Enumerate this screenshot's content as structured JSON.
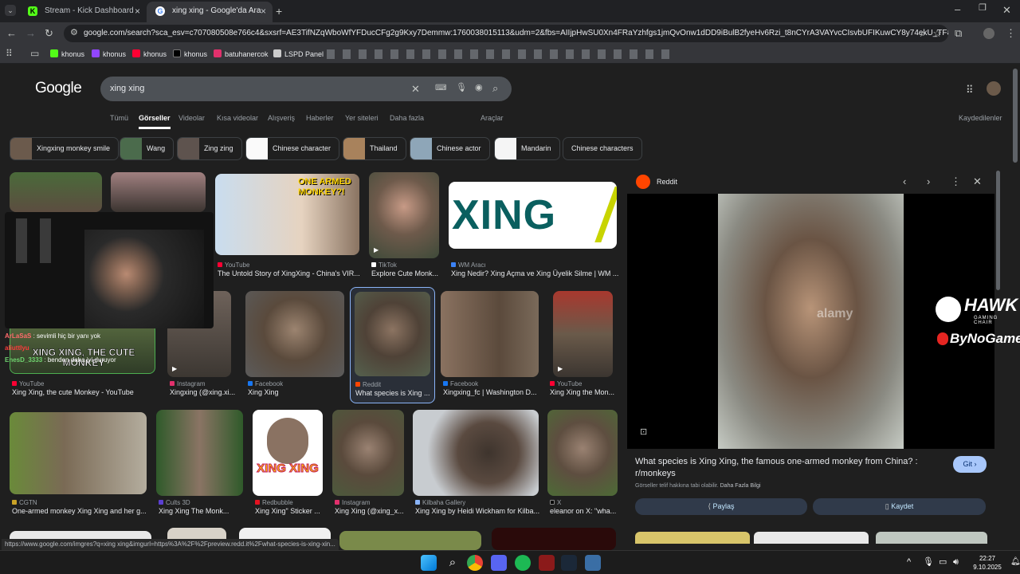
{
  "browser": {
    "tabs": [
      {
        "label": "Stream - Kick Dashboard"
      },
      {
        "label": "xing xing - Google'da Ara"
      }
    ],
    "url": "google.com/search?sca_esv=c707080508e766c4&sxsrf=AE3TifNZqWboWfYFDucCFg2g9Kxy7Demmw:1760038015113&udm=2&fbs=AIIjpHwSU0Xn4FRaYzhfgs1jmQvOnw1dDD9iBulB2fyeHv6Rzi_t8nCYrA3VAYvcCIsvbUFIKuwCY8y74ekU_TF8DEwKt3g...",
    "bookmarks": [
      "khonus",
      "khonus",
      "khonus",
      "khonus",
      "batuhanercok",
      "LSPD Panel"
    ]
  },
  "google": {
    "logo": "Google",
    "query": "xing xing",
    "nav": [
      "Tümü",
      "Görseller",
      "Videolar",
      "Kısa videolar",
      "Alışveriş",
      "Haberler",
      "Yer siteleri",
      "Daha fazla",
      "Araçlar"
    ],
    "saved": "Kaydedilenler",
    "chips": [
      "Xingxing monkey smile",
      "Wang",
      "Zing zing",
      "Chinese character",
      "Thailand",
      "Chinese actor",
      "Mandarin",
      "Chinese characters"
    ]
  },
  "results": [
    {
      "source": "YouTube",
      "title": "The Untold Story of XingXing - China's VIR...",
      "thumb_text": "ONE ARMED MONKEY?!"
    },
    {
      "source": "TikTok",
      "title": "Explore Cute Monk..."
    },
    {
      "source": "WM Aracı",
      "title": "Xing Nedir? Xing Açma ve Xing Üyelik Silme | WM ...",
      "thumb_text": "XING"
    },
    {
      "source": "YouTube",
      "title": "Xing Xing, the cute Monkey - YouTube",
      "thumb_text": "XING XING, THE CUTE MONKEY"
    },
    {
      "source": "Instagram",
      "title": "Xingxing (@xing.xi..."
    },
    {
      "source": "Facebook",
      "title": "Xing Xing"
    },
    {
      "source": "Reddit",
      "title": "What species is Xing ..."
    },
    {
      "source": "Facebook",
      "title": "Xingxing_fc | Washington D..."
    },
    {
      "source": "YouTube",
      "title": "Xing Xing the Mon..."
    },
    {
      "source": "CGTN",
      "title": "One-armed monkey Xing Xing and her g..."
    },
    {
      "source": "Cults 3D",
      "title": "Xing Xing The Monk..."
    },
    {
      "source": "Redbubble",
      "title": "Xing Xing\" Sticker ...",
      "thumb_text": "XING XING"
    },
    {
      "source": "Instagram",
      "title": "Xing Xing (@xing_x..."
    },
    {
      "source": "Kilbaha Gallery",
      "title": "Xing Xing by Heidi Wickham for Kilba..."
    },
    {
      "source": "X",
      "title": "eleanor on X: \"wha..."
    }
  ],
  "stream_overlay": {
    "chat": [
      {
        "user": "ArLaSaS",
        "message": "sevimli hiç bir yanı yok"
      },
      {
        "user": "aliuttIyu",
        "message": ""
      },
      {
        "user": "EnesD_3333",
        "message": "benden daha iyi duruyor"
      }
    ]
  },
  "panel": {
    "source": "Reddit",
    "watermark": "alamy",
    "title": "What species is Xing Xing, the famous one-armed monkey from China? : r/monkeys",
    "go_label": "Git",
    "notice": "Görseller telif hakkına tabi olabilir.",
    "more_info": "Daha Fazla Bilgi",
    "share_label": "Paylaş",
    "save_label": "Kaydet"
  },
  "sponsor": {
    "brand1": "HAWK",
    "brand1_sub": "GAMING CHAIR",
    "brand2": "ByNoGame"
  },
  "status_url": "https://www.google.com/imgres?q=xing xing&imgurl=https%3A%2F%2Fpreview.redd.it%2Fwhat-species-is-xing-xin...",
  "clock": {
    "time": "22:27",
    "date": "9.10.2025"
  }
}
